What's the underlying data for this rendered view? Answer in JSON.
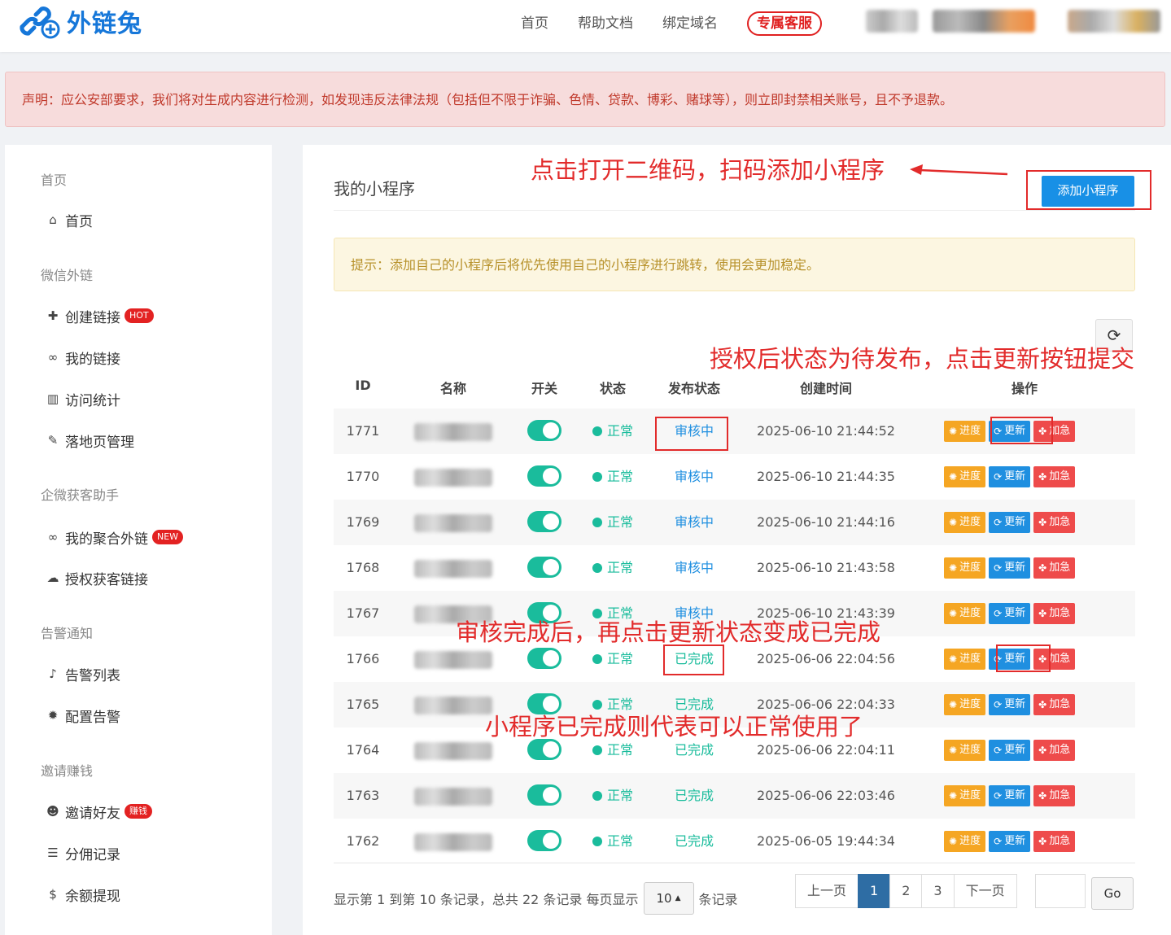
{
  "header": {
    "brand": "外链兔",
    "nav": [
      "首页",
      "帮助文档",
      "绑定域名"
    ],
    "service_label": "专属客服"
  },
  "notice": "声明：应公安部要求，我们将对生成内容进行检测，如发现违反法律法规（包括但不限于诈骗、色情、贷款、博彩、赌球等），则立即封禁相关账号，且不予退款。",
  "sidebar": {
    "sections": [
      {
        "title": "首页",
        "items": [
          {
            "icon": "home-icon",
            "label": "首页"
          }
        ]
      },
      {
        "title": "微信外链",
        "items": [
          {
            "icon": "plus-icon",
            "label": "创建链接",
            "badge": "HOT"
          },
          {
            "icon": "link-icon",
            "label": "我的链接"
          },
          {
            "icon": "bar-chart-icon",
            "label": "访问统计"
          },
          {
            "icon": "magic-wand-icon",
            "label": "落地页管理"
          }
        ]
      },
      {
        "title": "企微获客助手",
        "items": [
          {
            "icon": "link-icon",
            "label": "我的聚合外链",
            "badge": "NEW"
          },
          {
            "icon": "wechat-icon",
            "label": "授权获客链接"
          }
        ]
      },
      {
        "title": "告警通知",
        "items": [
          {
            "icon": "bell-icon",
            "label": "告警列表"
          },
          {
            "icon": "gear-icon",
            "label": "配置告警"
          }
        ]
      },
      {
        "title": "邀请赚钱",
        "items": [
          {
            "icon": "users-icon",
            "label": "邀请好友",
            "badge": "赚钱"
          },
          {
            "icon": "list-icon",
            "label": "分佣记录"
          },
          {
            "icon": "dollar-icon",
            "label": "余额提现"
          }
        ]
      }
    ]
  },
  "main": {
    "title": "我的小程序",
    "add_button": "添加小程序",
    "tip": "提示：添加自己的小程序后将优先使用自己的小程序进行跳转，使用会更加稳定。",
    "table": {
      "headers": [
        "ID",
        "名称",
        "开关",
        "状态",
        "发布状态",
        "创建时间",
        "操作"
      ],
      "rows": [
        {
          "id": "1771",
          "status": "正常",
          "publish": "审核中",
          "publish_kind": "review",
          "created": "2025-06-10 21:44:52"
        },
        {
          "id": "1770",
          "status": "正常",
          "publish": "审核中",
          "publish_kind": "review",
          "created": "2025-06-10 21:44:35"
        },
        {
          "id": "1769",
          "status": "正常",
          "publish": "审核中",
          "publish_kind": "review",
          "created": "2025-06-10 21:44:16"
        },
        {
          "id": "1768",
          "status": "正常",
          "publish": "审核中",
          "publish_kind": "review",
          "created": "2025-06-10 21:43:58"
        },
        {
          "id": "1767",
          "status": "正常",
          "publish": "审核中",
          "publish_kind": "review",
          "created": "2025-06-10 21:43:39"
        },
        {
          "id": "1766",
          "status": "正常",
          "publish": "已完成",
          "publish_kind": "done",
          "created": "2025-06-06 22:04:56"
        },
        {
          "id": "1765",
          "status": "正常",
          "publish": "已完成",
          "publish_kind": "done",
          "created": "2025-06-06 22:04:33"
        },
        {
          "id": "1764",
          "status": "正常",
          "publish": "已完成",
          "publish_kind": "done",
          "created": "2025-06-06 22:04:11"
        },
        {
          "id": "1763",
          "status": "正常",
          "publish": "已完成",
          "publish_kind": "done",
          "created": "2025-06-06 22:03:46"
        },
        {
          "id": "1762",
          "status": "正常",
          "publish": "已完成",
          "publish_kind": "done",
          "created": "2025-06-05 19:44:34"
        }
      ],
      "actions": {
        "progress": "进度",
        "update": "更新",
        "urgent": "加急"
      }
    },
    "footer": {
      "info_prefix": "显示第 1 到第 10 条记录，总共 22 条记录 每页显示",
      "page_size": "10",
      "info_suffix": "条记录",
      "pages": [
        "上一页",
        "1",
        "2",
        "3",
        "下一页"
      ],
      "active_page": "1",
      "go": "Go"
    }
  },
  "annotations": {
    "add_hint": "点击打开二维码，扫码添加小程序",
    "update_hint": "授权后状态为待发布，点击更新按钮提交",
    "done_hint": "审核完成后，再点击更新状态变成已完成",
    "usable_hint": "小程序已完成则代表可以正常使用了",
    "color": "#e22b2b"
  },
  "colors": {
    "primary": "#1890e6",
    "success": "#1abc9c",
    "warning": "#f5a623",
    "danger": "#ee4b4b"
  }
}
